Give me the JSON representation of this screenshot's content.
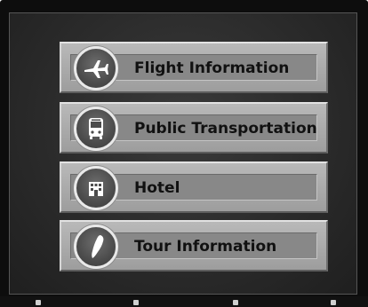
{
  "menu": {
    "items": [
      {
        "label": "Flight Information",
        "icon": "airplane-icon"
      },
      {
        "label": "Public Transportation",
        "icon": "bus-icon"
      },
      {
        "label": "Hotel",
        "icon": "hotel-icon"
      },
      {
        "label": "Tour Information",
        "icon": "taiwan-map-icon"
      }
    ]
  },
  "colors": {
    "bezel": "#0d0d0d",
    "screen": "#2b2b2b",
    "button_face": "#a8a8a8",
    "label": "#111111"
  }
}
